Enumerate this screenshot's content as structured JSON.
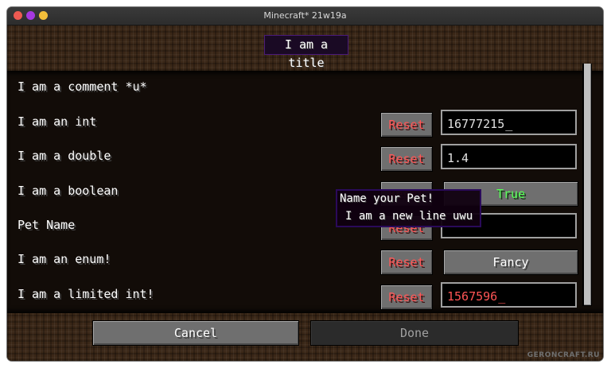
{
  "window": {
    "title": "Minecraft* 21w19a"
  },
  "screen": {
    "title": "I am a title"
  },
  "entries": {
    "comment": {
      "label": "I am a comment *u*"
    },
    "int": {
      "label": "I am an int",
      "reset": "Reset",
      "value": "16777215",
      "caret": "_"
    },
    "double": {
      "label": "I am a double",
      "reset": "Reset",
      "value": "1.4"
    },
    "boolean": {
      "label": "I am a boolean",
      "reset": "Reset",
      "value": "True"
    },
    "pet": {
      "label": "Pet Name",
      "reset": "Reset",
      "value": ""
    },
    "enum": {
      "label": "I am an enum!",
      "reset": "Reset",
      "value": "Fancy"
    },
    "limited": {
      "label": "I am a limited int!",
      "reset": "Reset",
      "value": "1567596",
      "caret": "_"
    }
  },
  "tooltip": {
    "line1": "Name your Pet!",
    "line2": "I am a new line uwu"
  },
  "footer": {
    "cancel": "Cancel",
    "done": "Done"
  },
  "watermark": "GERONCRAFT.RU",
  "colors": {
    "reset_text": "#ff5555",
    "true_text": "#55ff55",
    "tooltip_border": "#2a0a5a"
  }
}
